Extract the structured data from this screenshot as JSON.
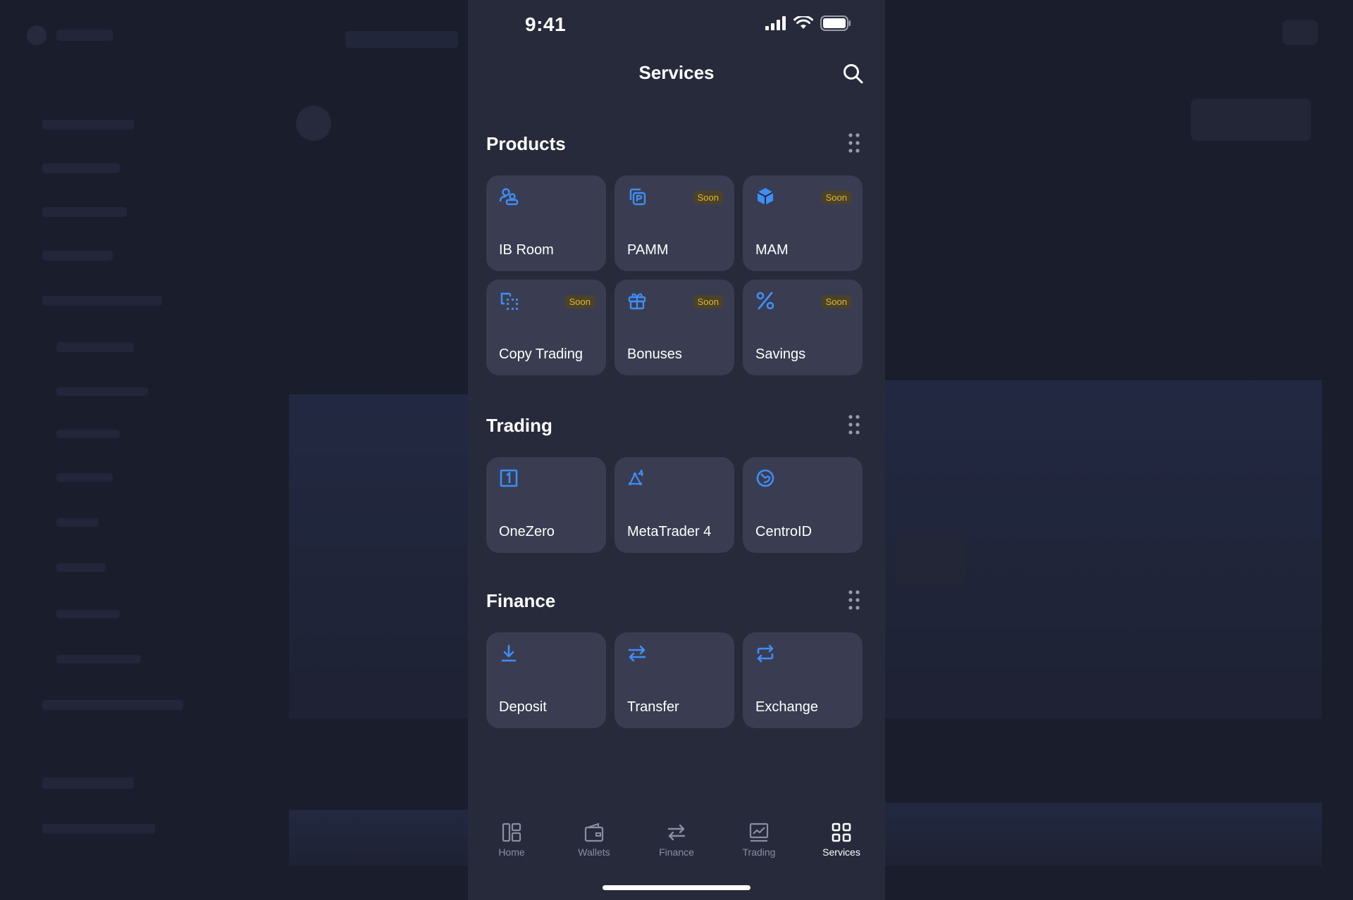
{
  "status_bar": {
    "time": "9:41"
  },
  "header": {
    "title": "Services"
  },
  "colors": {
    "accent": "#3e8ef7",
    "badge_text": "#e0b53a",
    "card_bg": "#3a3d51",
    "screen_bg": "#272a3b"
  },
  "sections": {
    "products": {
      "title": "Products",
      "items": [
        {
          "label": "IB Room",
          "icon": "ib-room-icon",
          "badge": ""
        },
        {
          "label": "PAMM",
          "icon": "pamm-icon",
          "badge": "Soon"
        },
        {
          "label": "MAM",
          "icon": "mam-cube-icon",
          "badge": "Soon"
        },
        {
          "label": "Copy Trading",
          "icon": "copy-trading-icon",
          "badge": "Soon"
        },
        {
          "label": "Bonuses",
          "icon": "gift-icon",
          "badge": "Soon"
        },
        {
          "label": "Savings",
          "icon": "percent-icon",
          "badge": "Soon"
        }
      ]
    },
    "trading": {
      "title": "Trading",
      "items": [
        {
          "label": "OneZero",
          "icon": "onezero-icon"
        },
        {
          "label": "MetaTrader 4",
          "icon": "metatrader-icon"
        },
        {
          "label": "CentroID",
          "icon": "centroid-icon"
        }
      ]
    },
    "finance": {
      "title": "Finance",
      "items": [
        {
          "label": "Deposit",
          "icon": "deposit-icon"
        },
        {
          "label": "Transfer",
          "icon": "transfer-icon"
        },
        {
          "label": "Exchange",
          "icon": "exchange-icon"
        }
      ]
    }
  },
  "tabbar": {
    "items": [
      {
        "label": "Home",
        "icon": "home-icon"
      },
      {
        "label": "Wallets",
        "icon": "wallet-icon"
      },
      {
        "label": "Finance",
        "icon": "finance-icon"
      },
      {
        "label": "Trading",
        "icon": "trading-icon"
      },
      {
        "label": "Services",
        "icon": "services-icon"
      }
    ],
    "active": "Services"
  }
}
